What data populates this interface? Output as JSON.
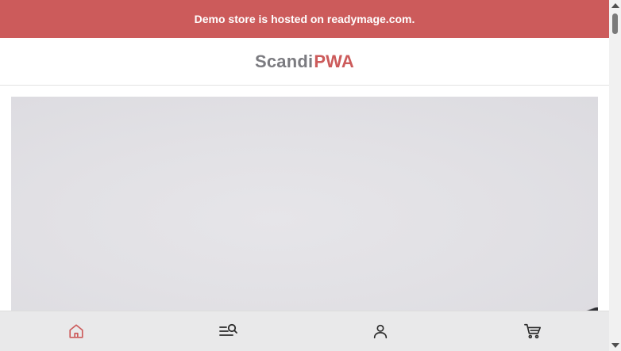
{
  "banner": {
    "text": "Demo store is hosted on readymage.com."
  },
  "header": {
    "logo_part1": "Scandi",
    "logo_part2": "PWA"
  },
  "bottom_nav": {
    "items": [
      {
        "icon": "home-icon",
        "active": true
      },
      {
        "icon": "menu-search-icon",
        "active": false
      },
      {
        "icon": "account-icon",
        "active": false
      },
      {
        "icon": "cart-icon",
        "active": false
      }
    ]
  },
  "colors": {
    "brand": "#cc5b5b",
    "logo_gray": "#7b7b80",
    "nav_background": "#e9e9ea",
    "icon": "#2b2b2b"
  }
}
